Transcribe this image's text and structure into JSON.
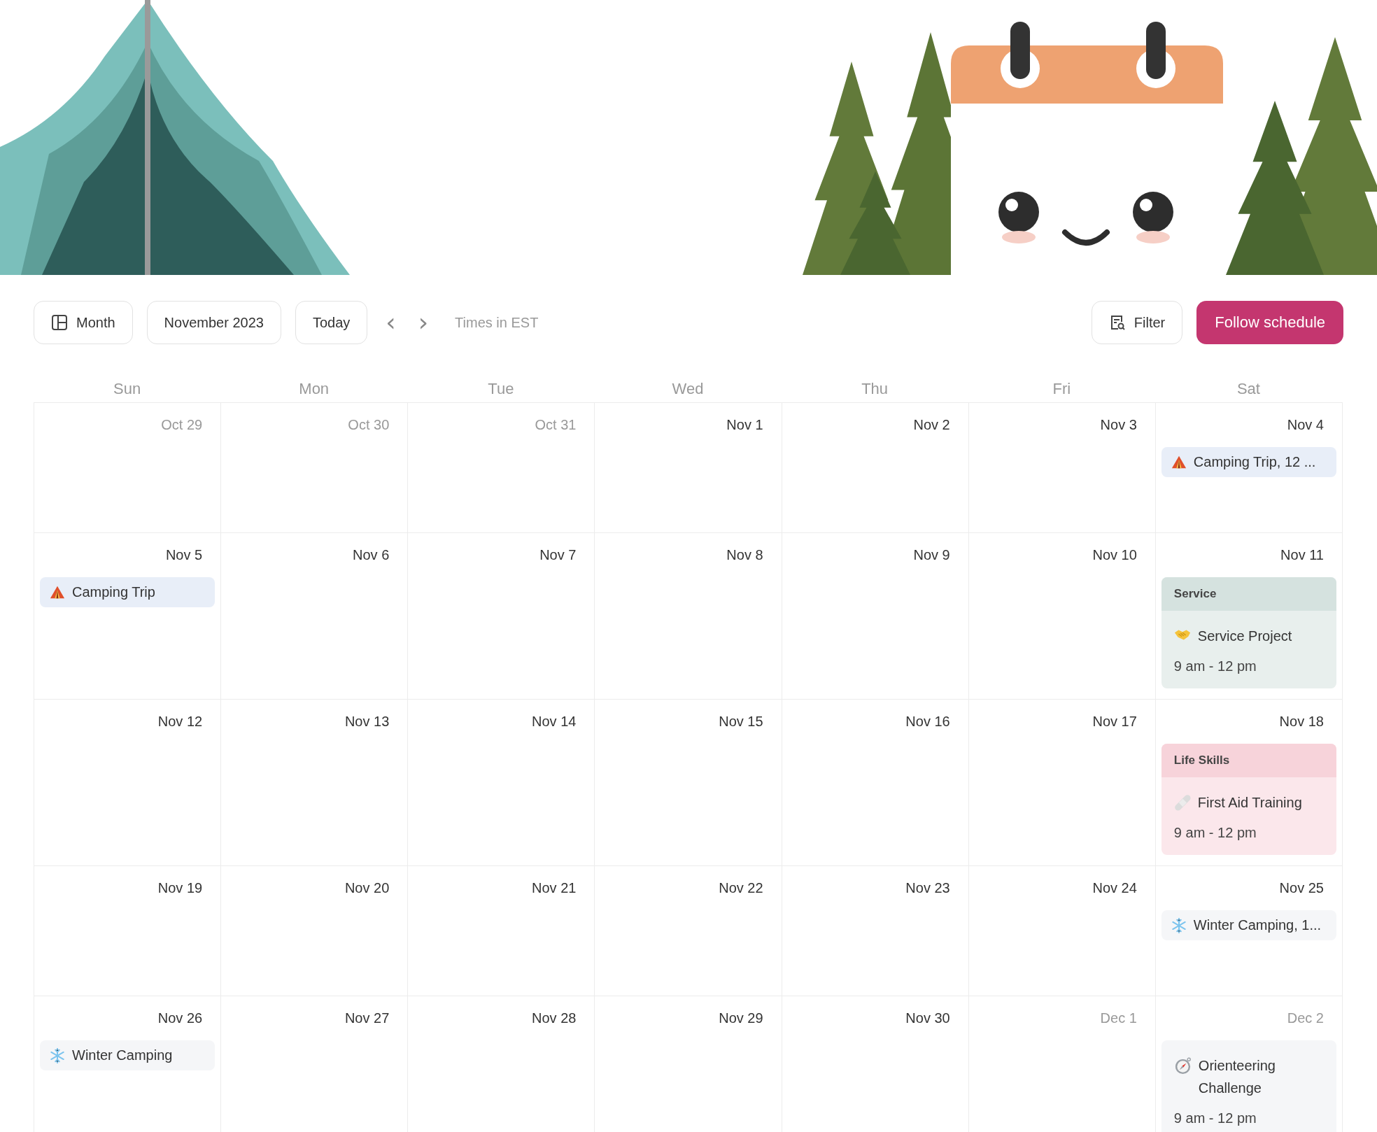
{
  "toolbar": {
    "view_button": "Month",
    "period_button": "November 2023",
    "today_button": "Today",
    "prev_symbol": "‹",
    "next_symbol": "›",
    "timezone": "Times in EST",
    "filter_button": "Filter",
    "follow_button": "Follow schedule"
  },
  "weekdays": [
    "Sun",
    "Mon",
    "Tue",
    "Wed",
    "Thu",
    "Fri",
    "Sat"
  ],
  "weeks": [
    {
      "days": [
        {
          "date": "Oct 29",
          "in_month": false
        },
        {
          "date": "Oct 30",
          "in_month": false
        },
        {
          "date": "Oct 31",
          "in_month": false
        },
        {
          "date": "Nov 1",
          "in_month": true
        },
        {
          "date": "Nov 2",
          "in_month": true
        },
        {
          "date": "Nov 3",
          "in_month": true
        },
        {
          "date": "Nov 4",
          "in_month": true,
          "events": [
            {
              "kind": "camping",
              "title": "Camping Trip, 12 ...",
              "color": "#e8eef8"
            }
          ]
        }
      ]
    },
    {
      "days": [
        {
          "date": "Nov 5",
          "in_month": true,
          "events": [
            {
              "kind": "camping",
              "title": "Camping Trip",
              "color": "#e8eef8"
            }
          ]
        },
        {
          "date": "Nov 6",
          "in_month": true
        },
        {
          "date": "Nov 7",
          "in_month": true
        },
        {
          "date": "Nov 8",
          "in_month": true
        },
        {
          "date": "Nov 9",
          "in_month": true
        },
        {
          "date": "Nov 10",
          "in_month": true
        },
        {
          "date": "Nov 11",
          "in_month": true,
          "events": [
            {
              "kind": "service",
              "category": "Service",
              "title": "Service Project",
              "time": "9 am - 12 pm",
              "color": "#d5e2df"
            }
          ]
        }
      ]
    },
    {
      "days": [
        {
          "date": "Nov 12",
          "in_month": true
        },
        {
          "date": "Nov 13",
          "in_month": true
        },
        {
          "date": "Nov 14",
          "in_month": true
        },
        {
          "date": "Nov 15",
          "in_month": true
        },
        {
          "date": "Nov 16",
          "in_month": true
        },
        {
          "date": "Nov 17",
          "in_month": true
        },
        {
          "date": "Nov 18",
          "in_month": true,
          "events": [
            {
              "kind": "firstaid",
              "category": "Life Skills",
              "title": "First Aid Training",
              "time": "9 am - 12 pm",
              "color": "#f7d3da"
            }
          ]
        }
      ]
    },
    {
      "days": [
        {
          "date": "Nov 19",
          "in_month": true
        },
        {
          "date": "Nov 20",
          "in_month": true
        },
        {
          "date": "Nov 21",
          "in_month": true
        },
        {
          "date": "Nov 22",
          "in_month": true
        },
        {
          "date": "Nov 23",
          "in_month": true
        },
        {
          "date": "Nov 24",
          "in_month": true
        },
        {
          "date": "Nov 25",
          "in_month": true,
          "events": [
            {
              "kind": "winter",
              "title": "Winter Camping, 1...",
              "color": "#f5f6f8"
            }
          ]
        }
      ]
    },
    {
      "days": [
        {
          "date": "Nov 26",
          "in_month": true,
          "events": [
            {
              "kind": "winter",
              "title": "Winter Camping",
              "color": "#f5f6f8"
            }
          ]
        },
        {
          "date": "Nov 27",
          "in_month": true
        },
        {
          "date": "Nov 28",
          "in_month": true
        },
        {
          "date": "Nov 29",
          "in_month": true
        },
        {
          "date": "Nov 30",
          "in_month": true
        },
        {
          "date": "Dec 1",
          "in_month": false
        },
        {
          "date": "Dec 2",
          "in_month": false,
          "events": [
            {
              "kind": "orienteering",
              "title": "Orienteering Challenge",
              "time": "9 am - 12 pm",
              "color": "#f5f6f8"
            }
          ]
        }
      ]
    }
  ]
}
